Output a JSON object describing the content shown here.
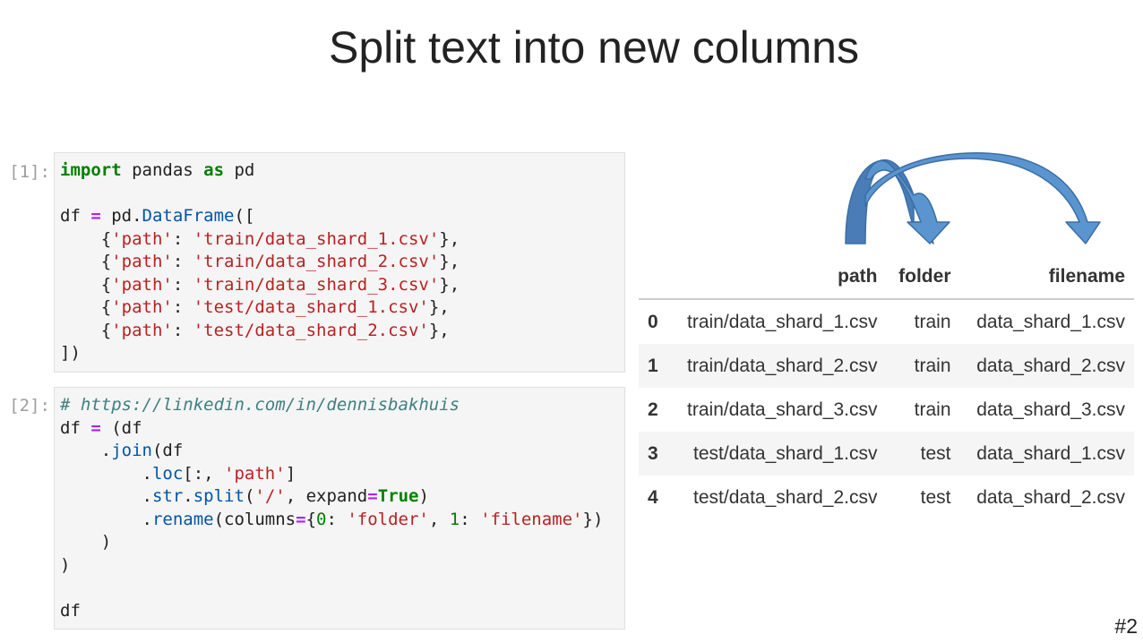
{
  "slide": {
    "title": "Split text into new columns",
    "page_number": "#2"
  },
  "cell1": {
    "prompt": "[1]:",
    "lines": [
      [
        [
          "kw",
          "import"
        ],
        [
          "t",
          " pandas "
        ],
        [
          "kw",
          "as"
        ],
        [
          "t",
          " pd"
        ]
      ],
      [],
      [
        [
          "t",
          "df "
        ],
        [
          "op",
          "="
        ],
        [
          "t",
          " pd."
        ],
        [
          "nm",
          "DataFrame"
        ],
        [
          "t",
          "(["
        ]
      ],
      [
        [
          "t",
          "    {"
        ],
        [
          "st",
          "'path'"
        ],
        [
          "t",
          ": "
        ],
        [
          "st",
          "'train/data_shard_1.csv'"
        ],
        [
          "t",
          "},"
        ]
      ],
      [
        [
          "t",
          "    {"
        ],
        [
          "st",
          "'path'"
        ],
        [
          "t",
          ": "
        ],
        [
          "st",
          "'train/data_shard_2.csv'"
        ],
        [
          "t",
          "},"
        ]
      ],
      [
        [
          "t",
          "    {"
        ],
        [
          "st",
          "'path'"
        ],
        [
          "t",
          ": "
        ],
        [
          "st",
          "'train/data_shard_3.csv'"
        ],
        [
          "t",
          "},"
        ]
      ],
      [
        [
          "t",
          "    {"
        ],
        [
          "st",
          "'path'"
        ],
        [
          "t",
          ": "
        ],
        [
          "st",
          "'test/data_shard_1.csv'"
        ],
        [
          "t",
          "},"
        ]
      ],
      [
        [
          "t",
          "    {"
        ],
        [
          "st",
          "'path'"
        ],
        [
          "t",
          ": "
        ],
        [
          "st",
          "'test/data_shard_2.csv'"
        ],
        [
          "t",
          "},"
        ]
      ],
      [
        [
          "t",
          "])"
        ]
      ]
    ]
  },
  "cell2": {
    "prompt": "[2]:",
    "lines": [
      [
        [
          "cm",
          "# https://linkedin.com/in/dennisbakhuis"
        ]
      ],
      [
        [
          "t",
          "df "
        ],
        [
          "op",
          "="
        ],
        [
          "t",
          " (df"
        ]
      ],
      [
        [
          "t",
          "    ."
        ],
        [
          "nm",
          "join"
        ],
        [
          "t",
          "(df"
        ]
      ],
      [
        [
          "t",
          "        ."
        ],
        [
          "nm",
          "loc"
        ],
        [
          "t",
          "[:, "
        ],
        [
          "st",
          "'path'"
        ],
        [
          "t",
          "]"
        ]
      ],
      [
        [
          "t",
          "        ."
        ],
        [
          "nm",
          "str"
        ],
        [
          "t",
          "."
        ],
        [
          "nm",
          "split"
        ],
        [
          "t",
          "("
        ],
        [
          "st",
          "'/'"
        ],
        [
          "t",
          ", expand"
        ],
        [
          "op",
          "="
        ],
        [
          "kw",
          "True"
        ],
        [
          "t",
          ")"
        ]
      ],
      [
        [
          "t",
          "        ."
        ],
        [
          "nm",
          "rename"
        ],
        [
          "t",
          "(columns"
        ],
        [
          "op",
          "="
        ],
        [
          "t",
          "{"
        ],
        [
          "num",
          "0"
        ],
        [
          "t",
          ": "
        ],
        [
          "st",
          "'folder'"
        ],
        [
          "t",
          ", "
        ],
        [
          "num",
          "1"
        ],
        [
          "t",
          ": "
        ],
        [
          "st",
          "'filename'"
        ],
        [
          "t",
          "})"
        ]
      ],
      [
        [
          "t",
          "    )"
        ]
      ],
      [
        [
          "t",
          ")"
        ]
      ],
      [],
      [
        [
          "t",
          "df"
        ]
      ]
    ]
  },
  "output_table": {
    "columns": [
      "path",
      "folder",
      "filename"
    ],
    "rows": [
      {
        "index": "0",
        "path": "train/data_shard_1.csv",
        "folder": "train",
        "filename": "data_shard_1.csv"
      },
      {
        "index": "1",
        "path": "train/data_shard_2.csv",
        "folder": "train",
        "filename": "data_shard_2.csv"
      },
      {
        "index": "2",
        "path": "train/data_shard_3.csv",
        "folder": "train",
        "filename": "data_shard_3.csv"
      },
      {
        "index": "3",
        "path": "test/data_shard_1.csv",
        "folder": "test",
        "filename": "data_shard_1.csv"
      },
      {
        "index": "4",
        "path": "test/data_shard_2.csv",
        "folder": "test",
        "filename": "data_shard_2.csv"
      }
    ]
  },
  "colors": {
    "keyword": "#008000",
    "operator": "#aa22ff",
    "name": "#0055aa",
    "string": "#ba2121",
    "comment": "#408080",
    "arrow_fill": "#5b95d0",
    "arrow_stroke": "#3a6ea5"
  },
  "icons": [
    "curved-arrow-icon"
  ]
}
